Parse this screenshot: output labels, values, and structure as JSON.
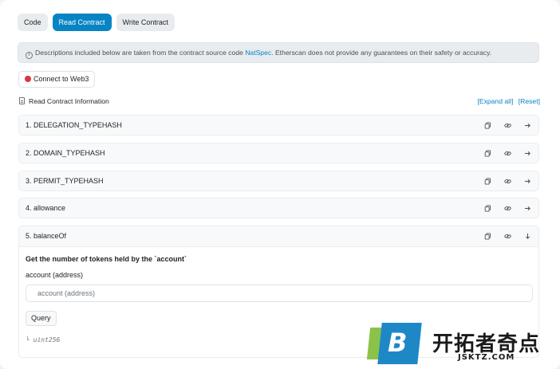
{
  "tabs": [
    {
      "label": "Code",
      "active": false
    },
    {
      "label": "Read Contract",
      "active": true
    },
    {
      "label": "Write Contract",
      "active": false
    }
  ],
  "notice": {
    "icon": "info-icon",
    "text_before": "Descriptions included below are taken from the contract source code ",
    "link": "NatSpec",
    "text_after": ". Etherscan does not provide any guarantees on their safety or accuracy."
  },
  "connect": {
    "label": "Connect to Web3",
    "status_color": "#dc3545"
  },
  "read_info": {
    "title": "Read Contract Information",
    "expand_all": "[Expand all]",
    "reset": "[Reset]"
  },
  "functions": [
    {
      "label": "1. DELEGATION_TYPEHASH"
    },
    {
      "label": "2. DOMAIN_TYPEHASH"
    },
    {
      "label": "3. PERMIT_TYPEHASH"
    },
    {
      "label": "4. allowance"
    }
  ],
  "expanded": {
    "label": "5. balanceOf",
    "description": "Get the number of tokens held by the `account`",
    "param_label": "account (address)",
    "input_placeholder": "account (address)",
    "query_label": "Query",
    "return_type": "└ uint256"
  },
  "watermark": {
    "letter": "B",
    "cn_text": "开拓者奇点",
    "en_text": "JSKTZ.COM"
  },
  "colors": {
    "accent": "#0784c3",
    "logo_green": "#8bc34a",
    "logo_blue": "#1e88c7"
  }
}
